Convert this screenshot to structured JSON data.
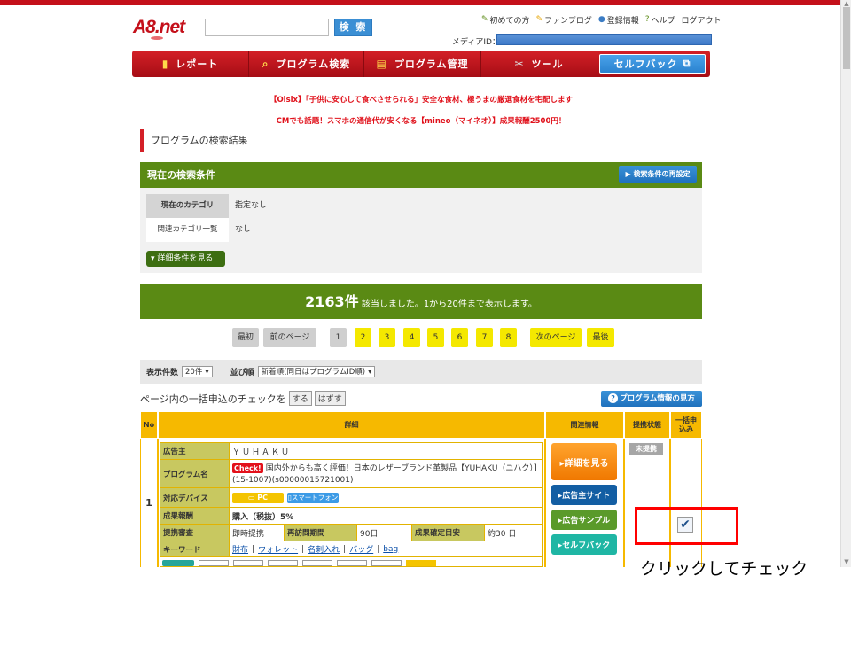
{
  "header": {
    "logo": "A8.net",
    "search_button": "検 索",
    "util_links": [
      {
        "icon": "✎",
        "label": "初めての方",
        "color": "#5a8a14"
      },
      {
        "icon": "✎",
        "label": "ファンブログ",
        "color": "#e6a400"
      },
      {
        "icon": "●",
        "label": "登録情報",
        "color": "#3b7cc4"
      },
      {
        "icon": "?",
        "label": "ヘルプ",
        "color": "#5a8a14"
      },
      {
        "icon": "",
        "label": "ログアウト",
        "color": "#333333"
      }
    ],
    "media_id_label": "メディアID："
  },
  "nav": {
    "items": [
      {
        "icon": "▮",
        "label": "レポート"
      },
      {
        "icon": "⌕",
        "label": "プログラム検索"
      },
      {
        "icon": "▤",
        "label": "プログラム管理"
      },
      {
        "icon": "✂",
        "label": "ツール"
      }
    ],
    "cashback": "セルフバック",
    "cashback_icon": "⧉"
  },
  "promos": [
    "【Oisix】「子供に安心して食べさせられる」安全な食材、極うまの厳選食材を宅配します",
    "CMでも話題！スマホの通信代が安くなる【mineo（マイネオ）】成果報酬2500円！"
  ],
  "page_title": "プログラムの検索結果",
  "conditions": {
    "title": "現在の検索条件",
    "reset_button": "▶ 検索条件の再設定",
    "rows": [
      {
        "key": "現在のカテゴリ",
        "value": "指定なし"
      },
      {
        "key": "関連カテゴリ一覧",
        "value": "なし"
      }
    ],
    "detail_button": "▾ 詳細条件を見る"
  },
  "result": {
    "count": "2163件",
    "text": " 該当しました。1から20件まで表示します。"
  },
  "pager": {
    "first": "最初",
    "prev": "前のページ",
    "pages": [
      "1",
      "2",
      "3",
      "4",
      "5",
      "6",
      "7",
      "8"
    ],
    "next": "次のページ",
    "last": "最後"
  },
  "sort": {
    "count_label": "表示件数",
    "count_value": "20件",
    "order_label": "並び順",
    "order_value": "新着順(同日はプログラムID順)"
  },
  "bulk": {
    "text": "ページ内の一括申込のチェックを",
    "do": "する",
    "undo": "はずす",
    "info_button": "プログラム情報の見方",
    "info_icon": "?"
  },
  "table": {
    "headers": {
      "no": "No",
      "detail": "詳細",
      "related": "関連情報",
      "status": "提携状態",
      "bulk": "一括申込み"
    },
    "row": {
      "no": "1",
      "advertiser_key": "広告主",
      "advertiser": "ＹＵＨＡＫＵ",
      "program_key": "プログラム名",
      "check_tag": "Check!",
      "program": "国内外からも高く評価！日本のレザーブランド革製品【YUHAKU（ユハク）】(15-1007)(s00000015721001)",
      "device_key": "対応デバイス",
      "device_pc": "PC",
      "device_sp": "スマートフォン",
      "reward_key": "成果報酬",
      "reward": "購入（税抜）5%",
      "review_key": "提携審査",
      "review": "即時提携",
      "revisit_key": "再訪問期間",
      "revisit": "90日",
      "confirm_key": "成果確定目安",
      "confirm": "約30 日",
      "keyword_key": "キーワード",
      "keywords": [
        "財布",
        "ウォレット",
        "名刺入れ",
        "バッグ",
        "bag"
      ],
      "status": "未提携",
      "buttons": {
        "detail": "▸詳細を見る",
        "site": "▸広告主サイト",
        "sample": "▸広告サンプル",
        "cashback": "▸セルフバック"
      }
    }
  },
  "annotation": "クリックしてチェック",
  "colors": {
    "brand": "#c4101a",
    "green": "#5a8a14",
    "orange": "#f6b900",
    "highlight": "#ff0000"
  }
}
